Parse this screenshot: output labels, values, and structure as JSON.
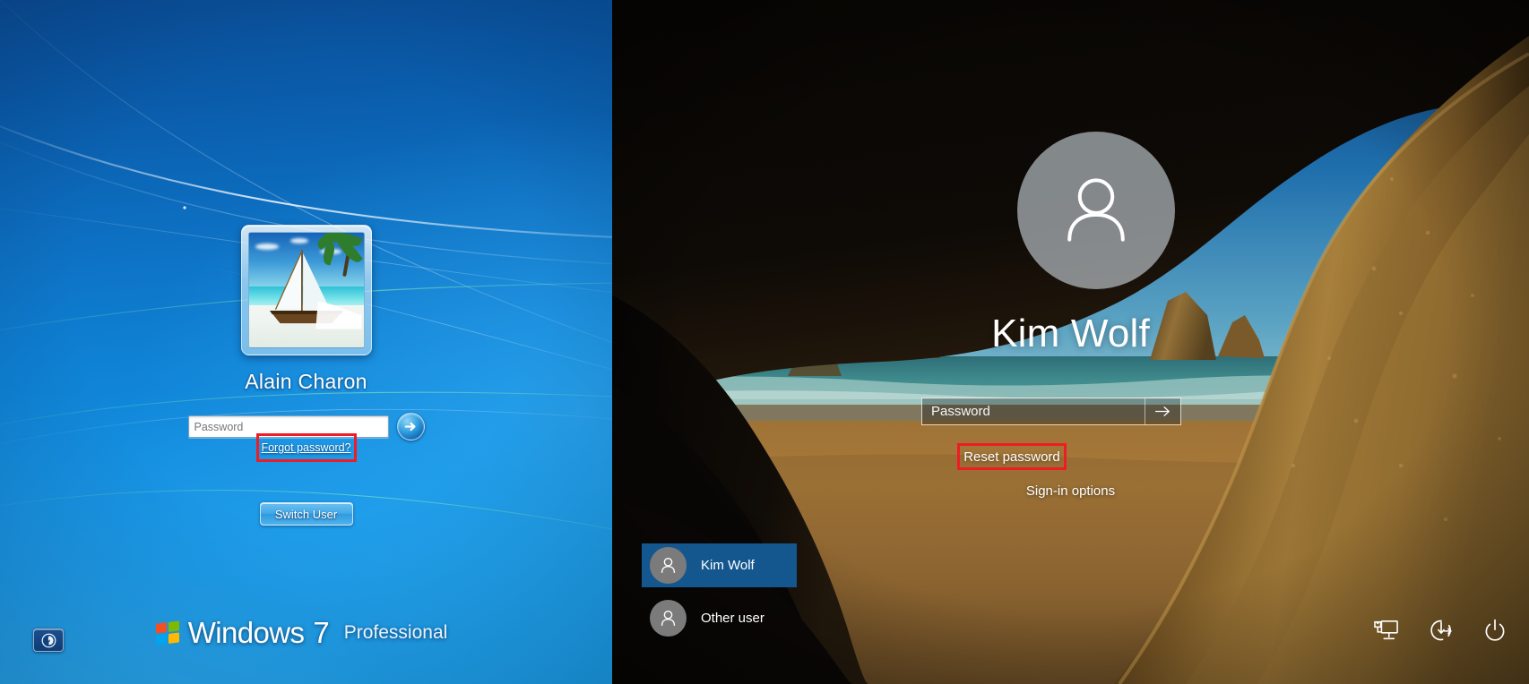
{
  "win7": {
    "os_name": "Windows",
    "os_trademark": "®",
    "os_version": "7",
    "os_edition": "Professional",
    "user": {
      "name": "Alain Charon",
      "picture": "sailboat-beach-avatar"
    },
    "password": {
      "placeholder": "Password",
      "value": ""
    },
    "submit_label": "Go",
    "forgot_link": "Forgot password?",
    "switch_user_label": "Switch User",
    "ease_of_access_label": "Ease of Access",
    "highlight_color": "#ee1c25",
    "accent_color": "#128fe0",
    "wallpaper": "windows-7-default-blue-light-rays"
  },
  "win10": {
    "user": {
      "name": "Kim Wolf",
      "picture": "default-person-avatar"
    },
    "password": {
      "placeholder": "Password",
      "value": ""
    },
    "submit_label": "Submit",
    "reset_link": "Reset password",
    "signin_options_label": "Sign-in options",
    "user_list": [
      {
        "label": "Kim Wolf",
        "selected": true
      },
      {
        "label": "Other user",
        "selected": false
      }
    ],
    "system_icons": [
      {
        "name": "network-icon",
        "label": "Network"
      },
      {
        "name": "ease-of-access-icon",
        "label": "Ease of Access"
      },
      {
        "name": "power-icon",
        "label": "Power"
      }
    ],
    "highlight_color": "#ee1c25",
    "selection_color": "#14578f",
    "wallpaper": "wharariki-beach-cave-windows-10"
  }
}
